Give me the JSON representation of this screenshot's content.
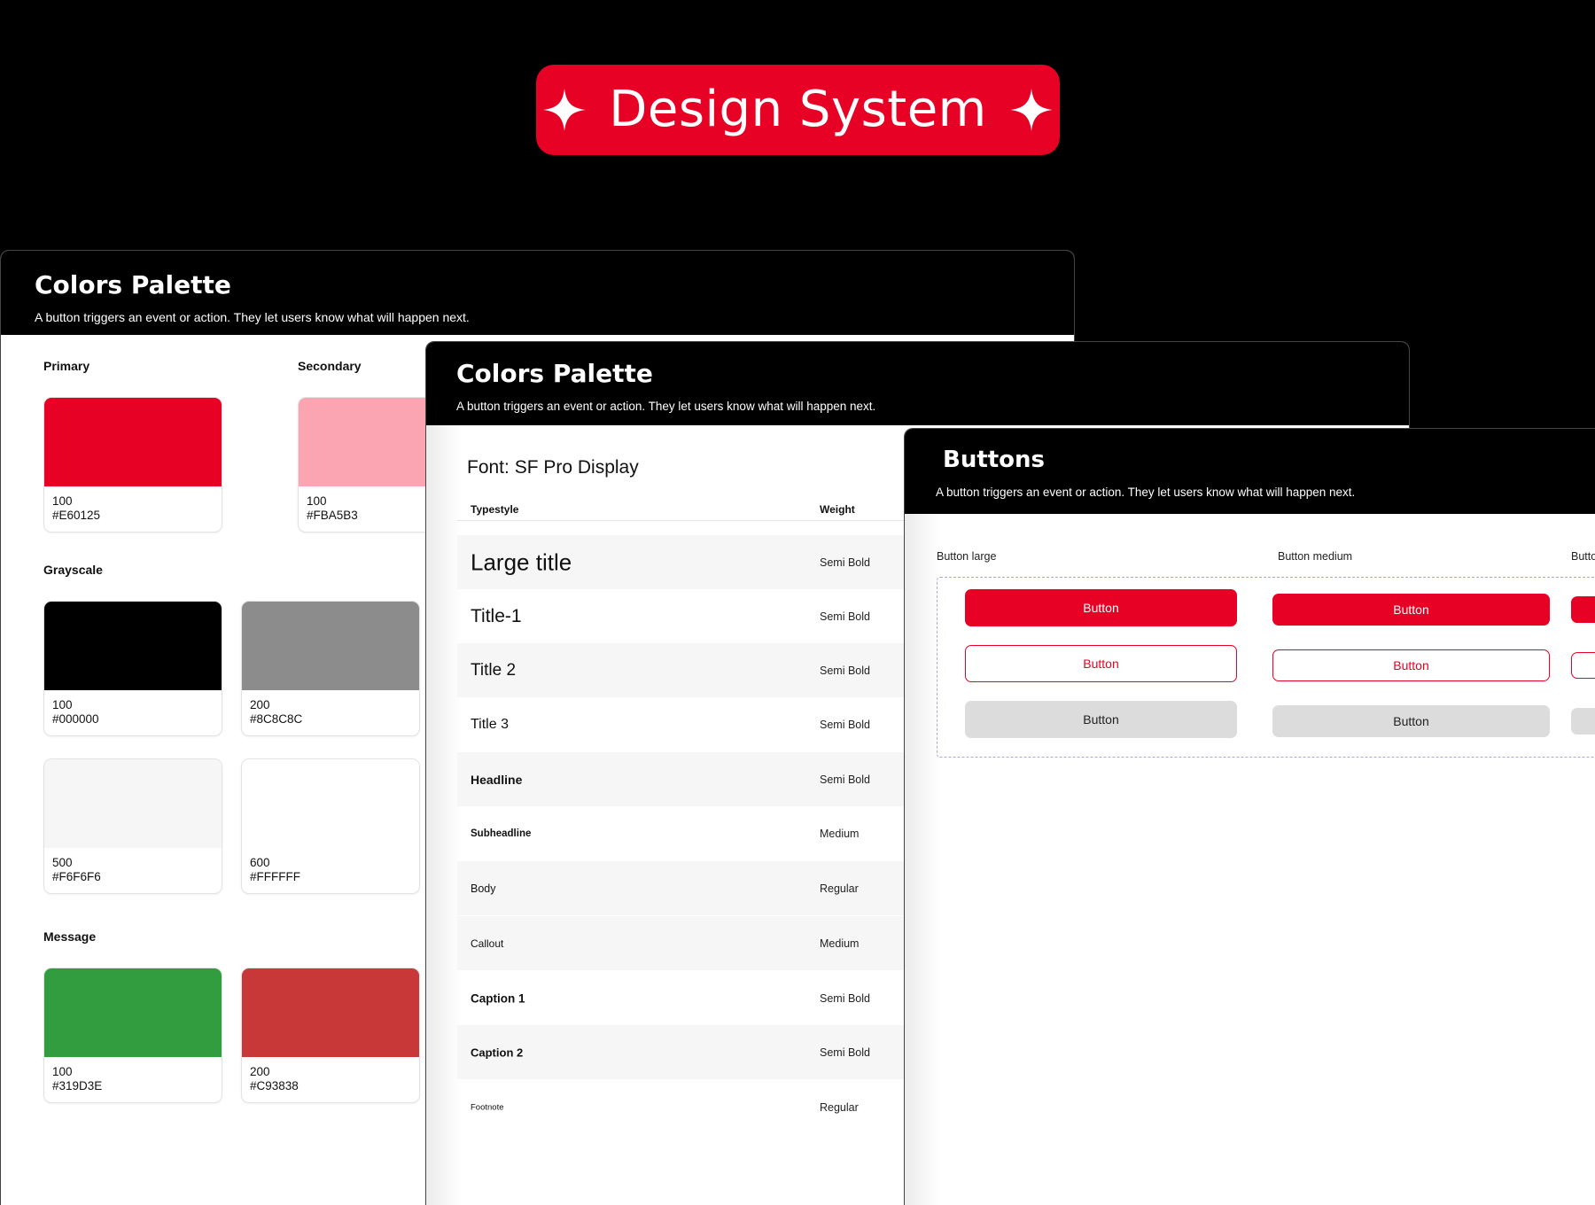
{
  "badge": {
    "title": "Design System",
    "icon": "sparkle-icon",
    "color": "#E60125"
  },
  "colors_panel": {
    "title": "Colors Palette",
    "description": "A button triggers an event or action. They let users know what will happen next.",
    "groups": {
      "primary": "Primary",
      "secondary": "Secondary",
      "grayscale": "Grayscale",
      "message": "Message"
    },
    "swatches": [
      {
        "id": "primary-100",
        "level": "100",
        "hex": "#E60125"
      },
      {
        "id": "secondary-100",
        "level": "100",
        "hex": "#FBA5B3"
      },
      {
        "id": "gray-100",
        "level": "100",
        "hex": "#000000"
      },
      {
        "id": "gray-200",
        "level": "200",
        "hex": "#8C8C8C"
      },
      {
        "id": "gray-500",
        "level": "500",
        "hex": "#F6F6F6"
      },
      {
        "id": "gray-600",
        "level": "600",
        "hex": "#FFFFFF"
      },
      {
        "id": "message-100",
        "level": "100",
        "hex": "#319D3E"
      },
      {
        "id": "message-200",
        "level": "200",
        "hex": "#C93838"
      }
    ]
  },
  "typography_panel": {
    "title": "Colors Palette",
    "description": "A button triggers an event or action. They let users know what will happen next.",
    "font_label": "Font: SF Pro Display",
    "columns": {
      "style": "Typestyle",
      "weight": "Weight"
    },
    "rows": [
      {
        "name": "Large title",
        "weight": "Semi Bold"
      },
      {
        "name": "Title-1",
        "weight": "Semi Bold"
      },
      {
        "name": "Title 2",
        "weight": "Semi Bold"
      },
      {
        "name": "Title 3",
        "weight": "Semi Bold"
      },
      {
        "name": "Headline",
        "weight": "Semi Bold"
      },
      {
        "name": "Subheadline",
        "weight": "Medium"
      },
      {
        "name": "Body",
        "weight": "Regular"
      },
      {
        "name": "Callout",
        "weight": "Medium"
      },
      {
        "name": "Caption 1",
        "weight": "Semi Bold"
      },
      {
        "name": "Caption 2",
        "weight": "Semi Bold"
      },
      {
        "name": "Footnote",
        "weight": "Regular"
      }
    ]
  },
  "buttons_panel": {
    "title": "Buttons",
    "description": "A button triggers an event or action. They let users know what will happen next.",
    "columns": [
      "Button large",
      "Button medium",
      "Butto"
    ],
    "button_label": "Button",
    "colors": {
      "primary": "#E60125",
      "ghost": "#DCDCDC"
    }
  }
}
